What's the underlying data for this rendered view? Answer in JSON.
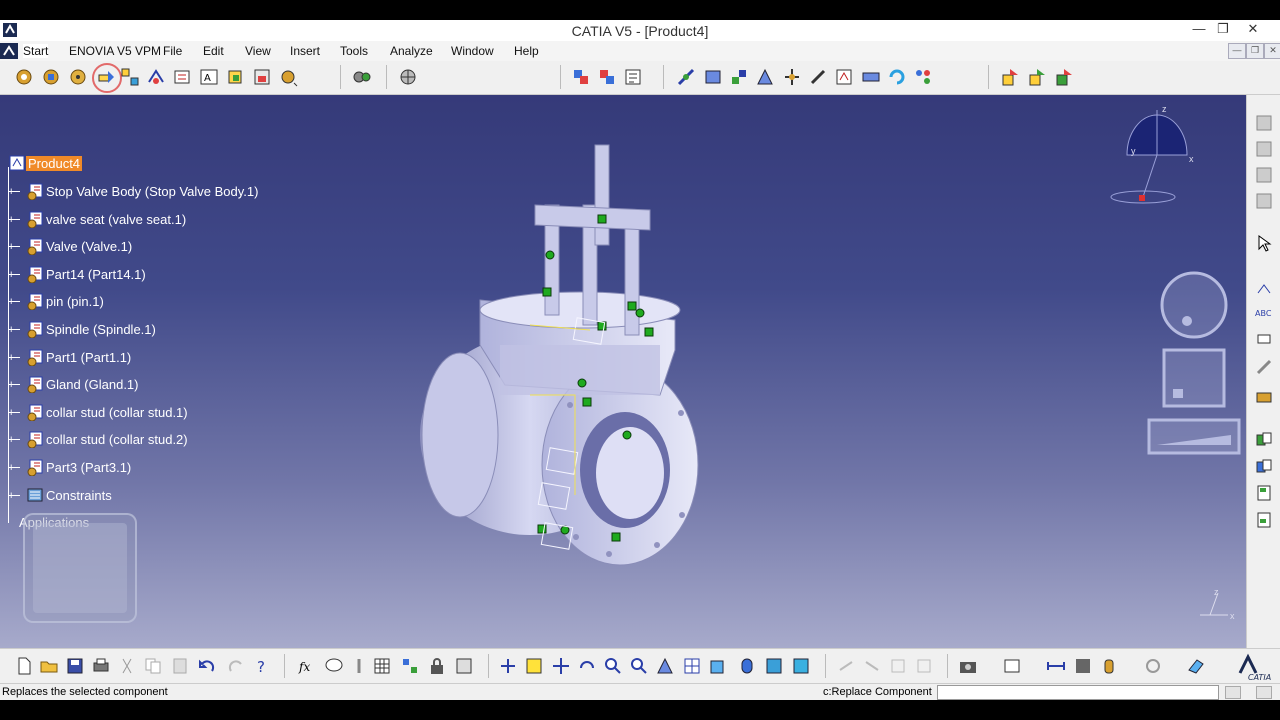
{
  "window": {
    "title": "CATIA V5 - [Product4]",
    "controls": [
      "—",
      "❐",
      "✕"
    ]
  },
  "menu": {
    "items": [
      "Start",
      "ENOVIA V5 VPM",
      "File",
      "Edit",
      "View",
      "Insert",
      "Tools",
      "Analyze",
      "Window",
      "Help"
    ]
  },
  "tree": {
    "root": "Product4",
    "nodes": [
      "Stop Valve Body (Stop Valve Body.1)",
      "valve seat (valve seat.1)",
      "Valve (Valve.1)",
      "Part14 (Part14.1)",
      "pin (pin.1)",
      "Spindle (Spindle.1)",
      "Part1 (Part1.1)",
      "Gland (Gland.1)",
      "collar stud (collar stud.1)",
      "collar stud (collar stud.2)",
      "Part3 (Part3.1)",
      "Constraints"
    ],
    "applications": "Applications"
  },
  "compass": {
    "x": "x",
    "y": "y",
    "z": "z"
  },
  "status": {
    "message": "Replaces the selected component",
    "command_label": "c:Replace Component",
    "command_value": ""
  },
  "brand": "CATIA",
  "colors": {
    "viewport_top": "#353a79",
    "viewport_bottom": "#a7aacb",
    "selection": "#f08a28",
    "constraint_green": "#1faa1f"
  },
  "icons": {
    "top_toolbar": [
      "product-icon",
      "component-icon",
      "part-icon",
      "replace-component-icon",
      "graph-tree-icon",
      "multi-instantiation-icon",
      "fast-multi-instantiation-icon",
      "reorder-icon",
      "manage-representations-icon",
      "numbering-icon",
      "scenes-icon",
      "explode-icon",
      "manipulate-icon",
      "snap-icon",
      "smart-move-icon",
      "coincidence-constraint-icon",
      "contact-constraint-icon",
      "offset-constraint-icon",
      "angle-constraint-icon",
      "fix-icon",
      "fix-together-icon",
      "quick-constraint-icon",
      "flexible-rigid-icon",
      "change-constraint-icon",
      "reuse-pattern-icon",
      "update-icon",
      "clash-icon",
      "sectioning-icon",
      "distance-icon"
    ],
    "bottom_toolbar": [
      "new-icon",
      "open-icon",
      "save-icon",
      "print-icon",
      "cut-icon",
      "copy-icon",
      "paste-icon",
      "undo-icon",
      "redo-icon",
      "whats-this-icon",
      "formula-icon",
      "comment-icon",
      "measure-icon",
      "grid-icon",
      "tree-icon",
      "catalog-icon",
      "swap-icon",
      "fly-mode-icon",
      "fit-all-icon",
      "pan-icon",
      "rotate-icon",
      "zoom-in-icon",
      "zoom-out-icon",
      "normal-view-icon",
      "views-icon",
      "quick-view-icon",
      "render-style-icon",
      "hide-show-icon",
      "swap-visible-icon",
      "cut-feature-icon",
      "capture-icon",
      "std-icon"
    ]
  }
}
